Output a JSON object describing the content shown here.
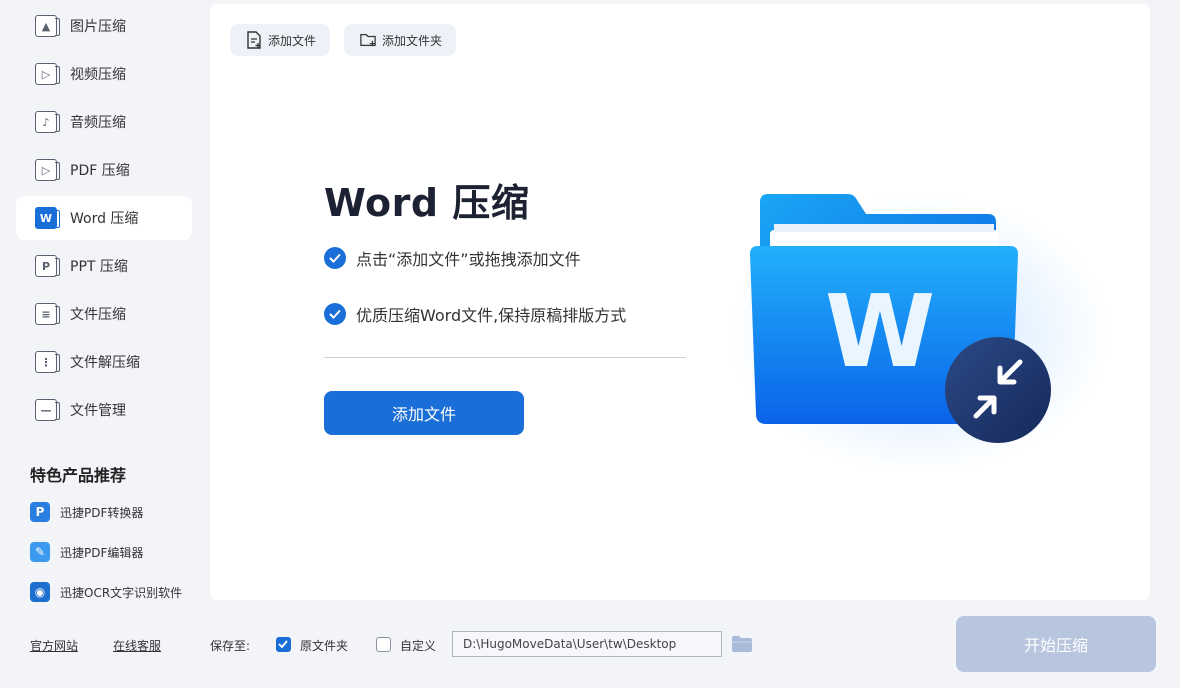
{
  "sidebar": {
    "items": [
      {
        "label": "图片压缩",
        "icon": "image-icon",
        "glyph": "▲"
      },
      {
        "label": "视频压缩",
        "icon": "video-icon",
        "glyph": "▷"
      },
      {
        "label": "音频压缩",
        "icon": "audio-icon",
        "glyph": "♪"
      },
      {
        "label": "PDF 压缩",
        "icon": "pdf-icon",
        "glyph": "▷"
      },
      {
        "label": "Word 压缩",
        "icon": "word-icon",
        "glyph": "W"
      },
      {
        "label": "PPT 压缩",
        "icon": "ppt-icon",
        "glyph": "P"
      },
      {
        "label": "文件压缩",
        "icon": "file-icon",
        "glyph": "≡"
      },
      {
        "label": "文件解压缩",
        "icon": "unzip-icon",
        "glyph": "⋮"
      },
      {
        "label": "文件管理",
        "icon": "folder-manage-icon",
        "glyph": "—"
      }
    ],
    "active_index": 4,
    "promo_title": "特色产品推荐",
    "promos": [
      {
        "label": "迅捷PDF转换器",
        "icon": "pdf-converter-icon",
        "glyph": "P",
        "color": "#2a7de1"
      },
      {
        "label": "迅捷PDF编辑器",
        "icon": "pdf-editor-icon",
        "glyph": "✎",
        "color": "#3c9bf0"
      },
      {
        "label": "迅捷OCR文字识别软件",
        "icon": "ocr-icon",
        "glyph": "◉",
        "color": "#1e6fd0"
      }
    ]
  },
  "main": {
    "add_file_top": "添加文件",
    "add_folder_top": "添加文件夹",
    "title": "Word 压缩",
    "features": [
      "点击“添加文件”或拖拽添加文件",
      "优质压缩Word文件,保持原稿排版方式"
    ],
    "add_file_button": "添加文件",
    "illustration_letter": "W"
  },
  "footer": {
    "official_site": "官方网站",
    "online_service": "在线客服",
    "save_to_label": "保存至:",
    "original_folder_label": "原文件夹",
    "original_folder_checked": true,
    "custom_label": "自定义",
    "custom_checked": false,
    "path": "D:\\HugoMoveData\\User\\tw\\Desktop",
    "start_button": "开始压缩"
  },
  "colors": {
    "accent": "#1a6ed8",
    "start_disabled": "#b7c6de",
    "background": "#f3f4f8"
  }
}
